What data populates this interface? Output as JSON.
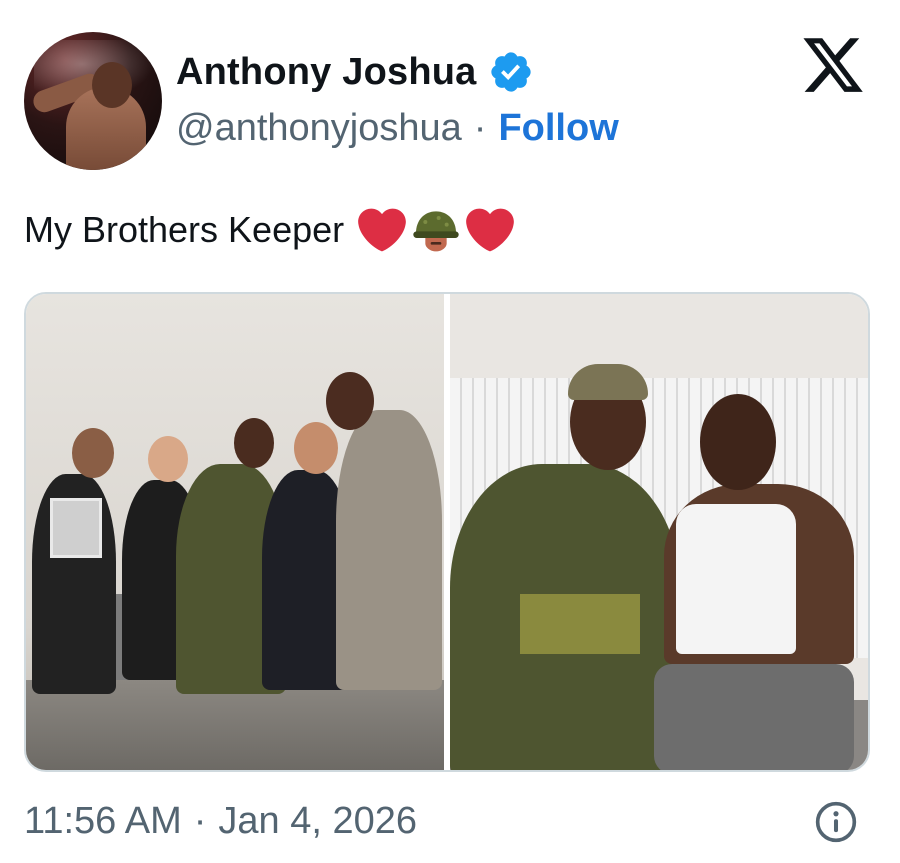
{
  "author": {
    "name": "Anthony Joshua",
    "handle": "@anthonyjoshua",
    "separator": "·",
    "follow_label": "Follow",
    "verified_color": "#1d9bf0"
  },
  "tweet": {
    "text": "My Brothers Keeper",
    "emojis": [
      "red-heart",
      "military-helmet",
      "red-heart"
    ]
  },
  "media": {
    "count": 2,
    "photos": [
      "group-photo-family-on-couch",
      "photo-two-men-posing"
    ]
  },
  "footer": {
    "time": "11:56 AM",
    "separator": "·",
    "date": "Jan 4, 2026"
  },
  "icons": {
    "logo": "x-logo-icon",
    "info": "info-icon"
  },
  "colors": {
    "link": "#1d74d8",
    "secondary_text": "#536471",
    "border": "#cfd9de"
  }
}
